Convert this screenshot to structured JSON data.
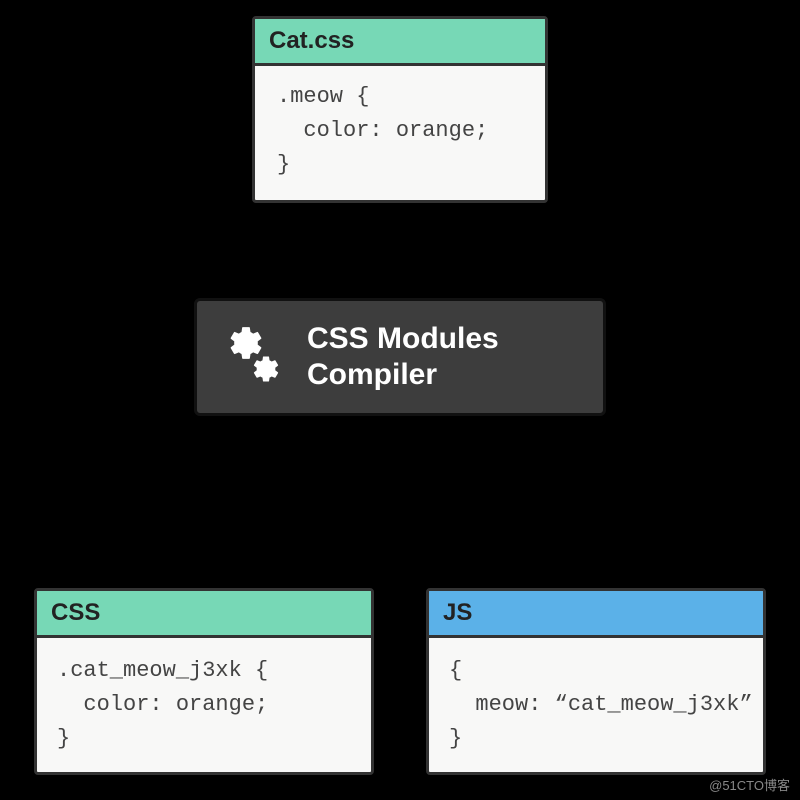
{
  "top": {
    "title": "Cat.css",
    "code": ".meow {\n  color: orange;\n}"
  },
  "compiler": {
    "line1": "CSS Modules",
    "line2": "Compiler"
  },
  "css": {
    "title": "CSS",
    "code": ".cat_meow_j3xk {\n  color: orange;\n}"
  },
  "js": {
    "title": "JS",
    "code": "{\n  meow: “cat_meow_j3xk”\n}"
  },
  "watermark": "@51CTO博客"
}
